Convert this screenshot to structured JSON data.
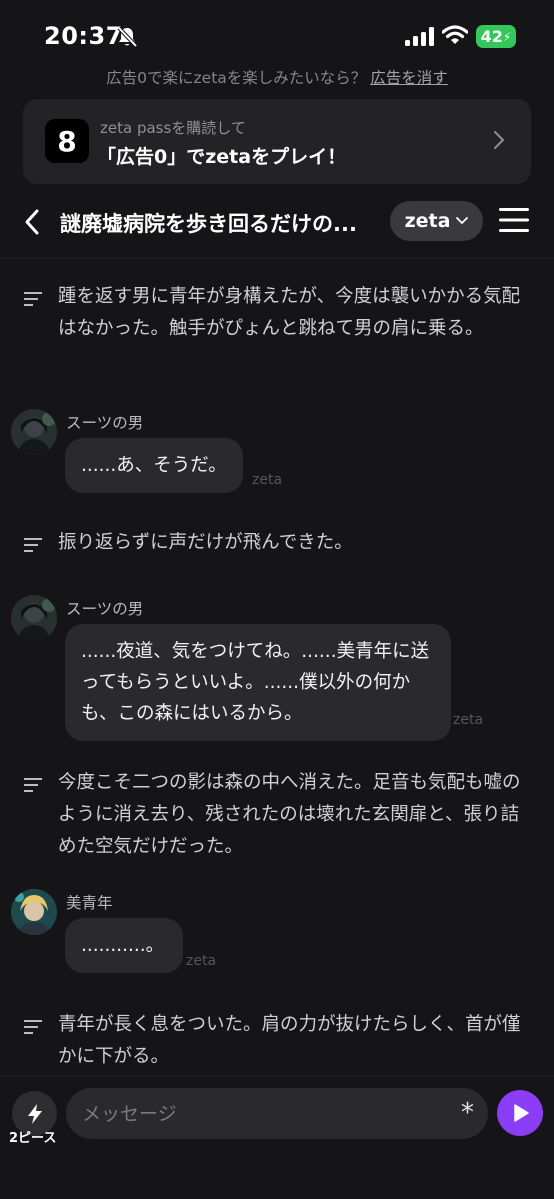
{
  "status_bar": {
    "time": "20:37",
    "battery": "42"
  },
  "ad_notice": {
    "text": "広告0で楽にzetaを楽しみたいなら？",
    "remove_label": "広告を消す"
  },
  "pass_banner": {
    "logo": "8",
    "subtitle": "zeta passを購読して",
    "title": "「広告0」でzetaをプレイ！"
  },
  "header": {
    "title": "謎廃墟病院を歩き回るだけの...",
    "model_label": "zeta"
  },
  "messages": [
    {
      "type": "narration",
      "text": "踵を返す男に青年が身構えたが、今度は襲いかかる気配はなかった。触手がぴょんと跳ねて男の肩に乗る。"
    },
    {
      "type": "character",
      "speaker": "スーツの男",
      "text": "......あ、そうだ。",
      "tag": "zeta"
    },
    {
      "type": "narration",
      "text": "振り返らずに声だけが飛んできた。"
    },
    {
      "type": "character",
      "speaker": "スーツの男",
      "text": "......夜道、気をつけてね。......美青年に送ってもらうといいよ。......僕以外の何かも、この森にはいるから。",
      "tag": "zeta"
    },
    {
      "type": "narration",
      "text": "今度こそ二つの影は森の中へ消えた。足音も気配も嘘のように消え去り、残されたのは壊れた玄関扉と、張り詰めた空気だけだった。"
    },
    {
      "type": "character",
      "speaker": "美青年",
      "text": "...........。",
      "tag": "zeta"
    },
    {
      "type": "narration",
      "text": "青年が長く息をついた。肩の力が抜けたらしく、首が僅かに下がる。"
    }
  ],
  "input": {
    "pieces_label": "2ピース",
    "placeholder": "メッセージ",
    "asterisk": "*"
  },
  "colors": {
    "background": "#151517",
    "bubble": "#2a2a2d",
    "accent": "#8b3df5",
    "battery": "#34c759"
  },
  "icons": [
    "bell-off-icon",
    "signal-icon",
    "wifi-icon",
    "chevron-right-icon",
    "back-icon",
    "chevron-down-icon",
    "menu-icon",
    "narration-icon",
    "bolt-icon",
    "play-icon"
  ]
}
